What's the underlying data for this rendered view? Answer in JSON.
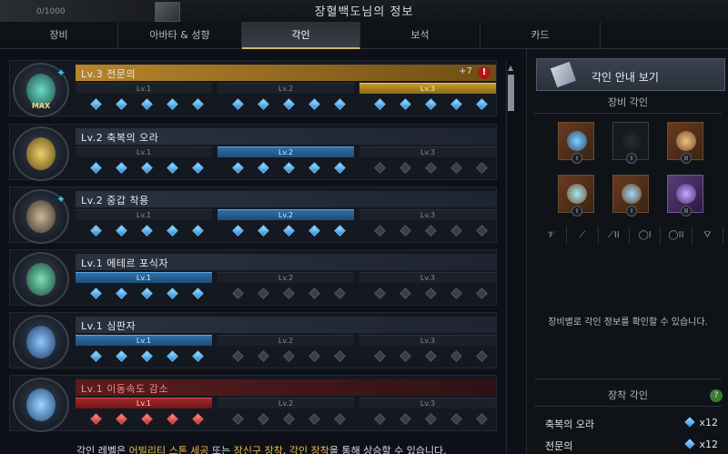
{
  "window": {
    "title": "장혈백도님의 정보",
    "counter": "0/1000"
  },
  "tabs": [
    {
      "label": "장비",
      "active": false
    },
    {
      "label": "아바타 & 성향",
      "active": false
    },
    {
      "label": "각인",
      "active": true
    },
    {
      "label": "보석",
      "active": false
    },
    {
      "label": "카드",
      "active": false
    }
  ],
  "engravings": [
    {
      "name": "Lv.3 전문의",
      "plus": "+7",
      "warn": "!",
      "badge": "MAX",
      "state": "gold",
      "levels": [
        "Lv.1",
        "Lv.2",
        "Lv.3"
      ],
      "active_segments": [
        false,
        false,
        true
      ]
    },
    {
      "name": "Lv.2 축복의 오라",
      "levels": [
        "Lv.1",
        "Lv.2",
        "Lv.3"
      ],
      "active_segments": [
        false,
        true,
        false
      ]
    },
    {
      "name": "Lv.2 중갑 착용",
      "levels": [
        "Lv.1",
        "Lv.2",
        "Lv.3"
      ],
      "active_segments": [
        false,
        true,
        false
      ]
    },
    {
      "name": "Lv.1 에테르 포식자",
      "levels": [
        "Lv.1",
        "Lv.2",
        "Lv.3"
      ],
      "active_segments": [
        true,
        false,
        false
      ]
    },
    {
      "name": "Lv.1 심판자",
      "levels": [
        "Lv.1",
        "Lv.2",
        "Lv.3"
      ],
      "active_segments": [
        true,
        false,
        false
      ]
    },
    {
      "name": "Lv.1 이동속도 감소",
      "state": "red",
      "levels": [
        "Lv.1",
        "Lv.2",
        "Lv.3"
      ],
      "active_segments": [
        true,
        false,
        false
      ]
    }
  ],
  "footer": {
    "part1": "각인 레벨은 ",
    "hl1": "어빌리티 스톤 세공",
    "part2": " 또는 ",
    "hl2": "장신구 장착",
    "part3": ", ",
    "hl3": "각인 장착",
    "part4": "을 통해 상승할 수 있습니다."
  },
  "side": {
    "guide_button": "각인 안내 보기",
    "equip_title": "장비 각인",
    "slot_marks": [
      "I",
      "I",
      "II",
      "I",
      "I",
      "II"
    ],
    "categories": [
      "𝒱",
      "⟋",
      "⟋II",
      "◯I",
      "◯II",
      "⛛"
    ],
    "hint": "장비별로 각인 정보를 확인할 수 있습니다.",
    "equipped_title": "장착 각인",
    "help": "?",
    "abilities": [
      {
        "name": "축복의 오라",
        "count": "x12"
      },
      {
        "name": "전문의",
        "count": "x12"
      }
    ]
  },
  "colors": {
    "accent_gold": "#d1b56c",
    "gem_blue": "#2a8be0",
    "penalty_red": "#a12a2a"
  }
}
